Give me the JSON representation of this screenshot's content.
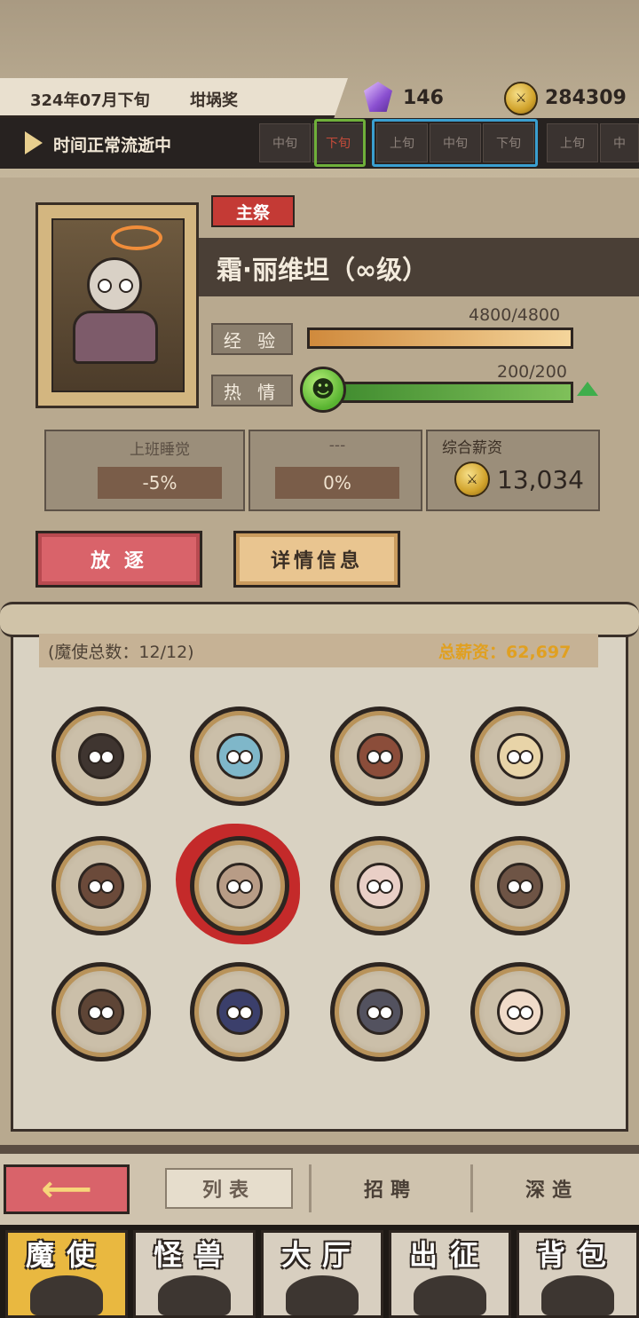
{
  "header": {
    "date": "324年07月下旬",
    "award": "坩埚奖",
    "crystals": "146",
    "crystal_icon": "purple-crystal-icon",
    "gold": "284309",
    "gold_icon": "gold-coin-icon"
  },
  "time_strip": {
    "status": "时间正常流逝中",
    "periods": [
      "中旬",
      "下旬",
      "上旬",
      "中旬",
      "下旬",
      "上旬",
      "中"
    ],
    "current_color": "#6fb03a",
    "next_color": "#3a9fd0"
  },
  "profile": {
    "role": "主祭",
    "name": "霜·丽维坦（∞级）",
    "exp_label": "经 验",
    "exp_value": "4800/4800",
    "exp_fraction": 1.0,
    "passion_label": "热 情",
    "passion_value": "200/200",
    "passion_fraction": 1.0
  },
  "traits": [
    {
      "title": "上班睡觉",
      "value": "-5%"
    },
    {
      "title": "---",
      "value": "0%"
    }
  ],
  "salary": {
    "label": "综合薪资",
    "value": "13,034"
  },
  "buttons": {
    "exile": "放 逐",
    "detail": "详情信息"
  },
  "list": {
    "count_text": "(魔使总数：12/12)",
    "total_text": "总薪资：62,697",
    "members": [
      {
        "name": "member-1",
        "color": "#3f3530"
      },
      {
        "name": "member-2",
        "color": "#7fb7c9"
      },
      {
        "name": "member-3",
        "color": "#8b4d3a"
      },
      {
        "name": "member-4",
        "color": "#e8d4a8"
      },
      {
        "name": "member-5",
        "color": "#6b4a3a"
      },
      {
        "name": "member-6",
        "color": "#b89c86"
      },
      {
        "name": "member-7",
        "color": "#e9cfc6"
      },
      {
        "name": "member-8",
        "color": "#6e5445"
      },
      {
        "name": "member-9",
        "color": "#5e4536"
      },
      {
        "name": "member-10",
        "color": "#3b3f6b"
      },
      {
        "name": "member-11",
        "color": "#53525f"
      },
      {
        "name": "member-12",
        "color": "#f0dbc9"
      }
    ],
    "selected_index": 5
  },
  "subtabs": [
    "列表",
    "招聘",
    "深造"
  ],
  "main_tabs": [
    "魔使",
    "怪兽",
    "大厅",
    "出征",
    "背包"
  ],
  "active_main_tab": 0
}
